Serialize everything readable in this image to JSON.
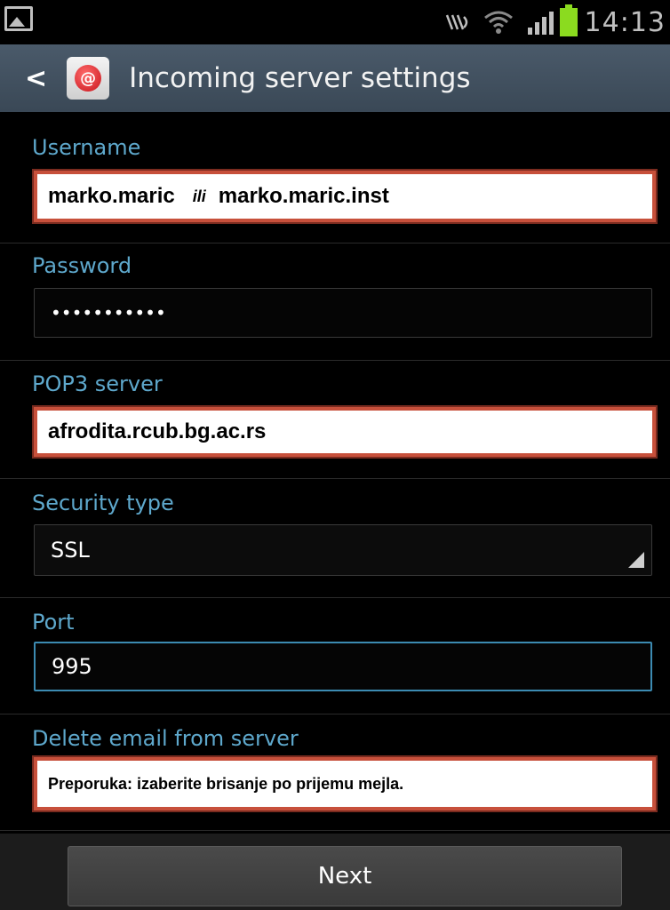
{
  "status_bar": {
    "time": "14:13",
    "icons": [
      "gallery-icon",
      "nfc-icon",
      "wifi-icon",
      "signal-icon",
      "battery-icon"
    ]
  },
  "header": {
    "back_symbol": "<",
    "app_icon_symbol": "@",
    "title": "Incoming server settings"
  },
  "form": {
    "username": {
      "label": "Username",
      "value_part1": "marko.maric",
      "separator": "ili",
      "value_part2": "marko.maric.inst"
    },
    "password": {
      "label": "Password",
      "value": "•••••••••••"
    },
    "pop3_server": {
      "label": "POP3 server",
      "value": "afrodita.rcub.bg.ac.rs"
    },
    "security_type": {
      "label": "Security type",
      "value": "SSL"
    },
    "port": {
      "label": "Port",
      "value": "995"
    },
    "delete_email": {
      "label": "Delete email from server",
      "value": "Preporuka: izaberite brisanje po prijemu mejla."
    }
  },
  "footer": {
    "next_label": "Next"
  },
  "colors": {
    "accent_label": "#5ea8cc",
    "highlight_border": "#c7503b",
    "battery": "#8bdb1f"
  }
}
